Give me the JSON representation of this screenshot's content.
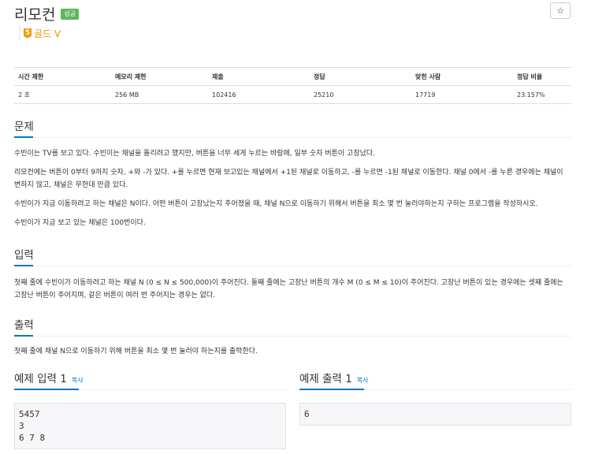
{
  "problem": {
    "title": "리모컨",
    "badge": "성공",
    "star": "☆",
    "tier_number": "5",
    "tier_label": "골드 V"
  },
  "stats": {
    "headers": [
      "시간 제한",
      "메모리 제한",
      "제출",
      "정답",
      "맞힌 사람",
      "정답 비율"
    ],
    "values": [
      "2 초",
      "256 MB",
      "102416",
      "25210",
      "17719",
      "23.157%"
    ]
  },
  "sections": {
    "description": {
      "title": "문제",
      "paragraphs": [
        "수빈이는 TV를 보고 있다. 수빈이는 채널을 돌리려고 했지만, 버튼을 너무 세게 누르는 바람에, 일부 숫자 버튼이 고장났다.",
        "리모컨에는 버튼이 0부터 9까지 숫자, +와 -가 있다. +를 누르면 현재 보고있는 채널에서 +1된 채널로 이동하고, -를 누르면 -1된 채널로 이동한다. 채널 0에서 -를 누른 경우에는 채널이 변하지 않고, 채널은 무한대 만큼 있다.",
        "수빈이가 지금 이동하려고 하는 채널은 N이다. 어떤 버튼이 고장났는지 주어졌을 때, 채널 N으로 이동하기 위해서 버튼을 최소 몇 번 눌러야하는지 구하는 프로그램을 작성하시오.",
        "수빈이가 지금 보고 있는 채널은 100번이다."
      ]
    },
    "input": {
      "title": "입력",
      "text": "첫째 줄에 수빈이가 이동하려고 하는 채널 N (0 ≤ N ≤ 500,000)이 주어진다. 둘째 줄에는 고장난 버튼의 개수 M (0 ≤ M ≤ 10)이 주어진다. 고장난 버튼이 있는 경우에는 셋째 줄에는 고장난 버튼이 주어지며, 같은 버튼이 여러 번 주어지는 경우는 없다."
    },
    "output": {
      "title": "출력",
      "text": "첫째 줄에 채널 N으로 이동하기 위해 버튼을 최소 몇 번 눌러야 하는지를 출력한다."
    }
  },
  "samples": {
    "input": {
      "title": "예제 입력 1",
      "copy": "복사",
      "content": "5457\n3\n6 7 8"
    },
    "output": {
      "title": "예제 출력 1",
      "copy": "복사",
      "content": "6"
    }
  }
}
